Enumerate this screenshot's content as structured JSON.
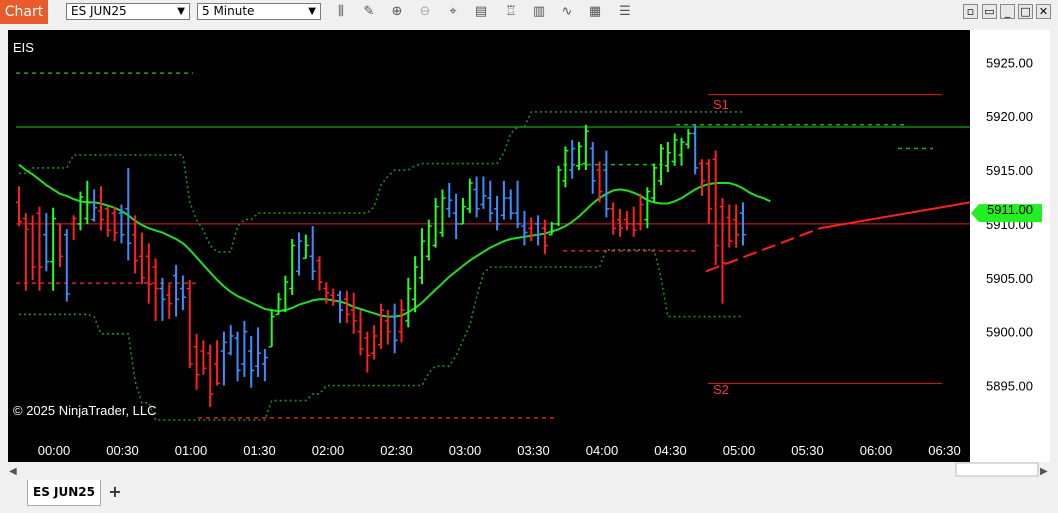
{
  "toolbar": {
    "app_label": "Chart",
    "instrument": "ES JUN25",
    "interval": "5 Minute",
    "tools": [
      "bar-type-icon",
      "draw-icon",
      "zoom-in-icon",
      "zoom-out-icon",
      "crosshair-icon",
      "data-box-icon",
      "strategies-icon",
      "indicators-icon",
      "drawing-tools-icon",
      "properties-icon",
      "chart-trader-icon"
    ],
    "window_buttons": [
      "snap-icon",
      "minimize-icon",
      "maximize-icon",
      "close-icon"
    ]
  },
  "chart": {
    "panel_label": "EIS",
    "copyright": "© 2025 NinjaTrader, LLC",
    "current_price_label": "5911.00",
    "s1_label": "S1",
    "s2_label": "S2",
    "colors": {
      "background": "#000000",
      "up": "#22ff22",
      "down": "#ff2020",
      "neutral": "#3a8eff",
      "ma": "#22dd22",
      "band": "#1f8f1f",
      "axis_text": "#ffffff"
    }
  },
  "chart_data": {
    "type": "bar",
    "instrument": "ES JUN25",
    "interval": "5 Minute",
    "y_ticks": [
      5925.0,
      5920.0,
      5915.0,
      5910.0,
      5905.0,
      5900.0,
      5895.0
    ],
    "x_ticks": [
      "00:00",
      "00:30",
      "01:00",
      "01:30",
      "02:00",
      "02:30",
      "03:00",
      "03:30",
      "04:00",
      "04:30",
      "05:00",
      "05:30",
      "06:00",
      "06:30"
    ],
    "ylim": [
      5890.5,
      5928
    ],
    "current_price": 5911.0,
    "levels": {
      "s1": 5922.0,
      "s2": 5895.2,
      "resistance": 5919.0,
      "support": 5910.0
    },
    "bars": [
      {
        "h": 5913.5,
        "l": 5909.8,
        "o": 5912.0,
        "c": 5910.2,
        "col": "r"
      },
      {
        "h": 5911.0,
        "l": 5903.8,
        "o": 5910.5,
        "c": 5909.5,
        "col": "r"
      },
      {
        "h": 5910.8,
        "l": 5904.8,
        "o": 5910.0,
        "c": 5906.0,
        "col": "r"
      },
      {
        "h": 5911.6,
        "l": 5903.8,
        "o": 5911.0,
        "c": 5906.0,
        "col": "r"
      },
      {
        "h": 5911.0,
        "l": 5905.6,
        "o": 5909.0,
        "c": 5906.5,
        "col": "b"
      },
      {
        "h": 5911.5,
        "l": 5903.8,
        "o": 5906.5,
        "c": 5910.5,
        "col": "g"
      },
      {
        "h": 5910.0,
        "l": 5906.0,
        "o": 5910.0,
        "c": 5907.0,
        "col": "r"
      },
      {
        "h": 5909.5,
        "l": 5902.8,
        "o": 5909.0,
        "c": 5903.5,
        "col": "b"
      },
      {
        "h": 5910.8,
        "l": 5908.5,
        "o": 5910.0,
        "c": 5910.5,
        "col": "r"
      },
      {
        "h": 5913.0,
        "l": 5909.4,
        "o": 5910.0,
        "c": 5912.5,
        "col": "g"
      },
      {
        "h": 5914.0,
        "l": 5910.0,
        "o": 5910.5,
        "c": 5912.0,
        "col": "g"
      },
      {
        "h": 5913.2,
        "l": 5910.2,
        "o": 5910.4,
        "c": 5911.5,
        "col": "b"
      },
      {
        "h": 5913.5,
        "l": 5909.4,
        "o": 5911.2,
        "c": 5910.4,
        "col": "r"
      },
      {
        "h": 5911.6,
        "l": 5908.8,
        "o": 5911.4,
        "c": 5909.4,
        "col": "r"
      },
      {
        "h": 5911.6,
        "l": 5908.4,
        "o": 5911.0,
        "c": 5909.2,
        "col": "r"
      },
      {
        "h": 5911.8,
        "l": 5908.2,
        "o": 5911.0,
        "c": 5909.0,
        "col": "b"
      },
      {
        "h": 5915.2,
        "l": 5906.6,
        "o": 5911.4,
        "c": 5908.2,
        "col": "b"
      },
      {
        "h": 5910.8,
        "l": 5905.4,
        "o": 5909.0,
        "c": 5906.6,
        "col": "r"
      },
      {
        "h": 5909.2,
        "l": 5904.4,
        "o": 5907.0,
        "c": 5905.0,
        "col": "r"
      },
      {
        "h": 5908.2,
        "l": 5902.6,
        "o": 5907.0,
        "c": 5904.4,
        "col": "r"
      },
      {
        "h": 5906.8,
        "l": 5901.0,
        "o": 5906.0,
        "c": 5904.0,
        "col": "r"
      },
      {
        "h": 5905.0,
        "l": 5901.0,
        "o": 5904.0,
        "c": 5903.0,
        "col": "b"
      },
      {
        "h": 5904.4,
        "l": 5901.2,
        "o": 5903.4,
        "c": 5902.6,
        "col": "r"
      },
      {
        "h": 5906.2,
        "l": 5901.4,
        "o": 5905.2,
        "c": 5903.0,
        "col": "b"
      },
      {
        "h": 5905.2,
        "l": 5902.0,
        "o": 5904.0,
        "c": 5903.2,
        "col": "b"
      },
      {
        "h": 5904.8,
        "l": 5896.6,
        "o": 5904.0,
        "c": 5897.0,
        "col": "r"
      },
      {
        "h": 5899.8,
        "l": 5894.6,
        "o": 5898.6,
        "c": 5896.0,
        "col": "r"
      },
      {
        "h": 5899.2,
        "l": 5896.0,
        "o": 5898.2,
        "c": 5896.6,
        "col": "r"
      },
      {
        "h": 5898.8,
        "l": 5893.0,
        "o": 5898.0,
        "c": 5894.2,
        "col": "r"
      },
      {
        "h": 5899.2,
        "l": 5895.0,
        "o": 5897.0,
        "c": 5895.2,
        "col": "r"
      },
      {
        "h": 5900.0,
        "l": 5895.0,
        "o": 5898.2,
        "c": 5899.0,
        "col": "b"
      },
      {
        "h": 5900.6,
        "l": 5897.8,
        "o": 5898.0,
        "c": 5899.6,
        "col": "b"
      },
      {
        "h": 5900.0,
        "l": 5895.4,
        "o": 5899.4,
        "c": 5896.4,
        "col": "b"
      },
      {
        "h": 5901.0,
        "l": 5895.8,
        "o": 5897.0,
        "c": 5900.0,
        "col": "b"
      },
      {
        "h": 5899.6,
        "l": 5894.8,
        "o": 5898.2,
        "c": 5896.4,
        "col": "b"
      },
      {
        "h": 5900.4,
        "l": 5895.8,
        "o": 5896.8,
        "c": 5898.0,
        "col": "b"
      },
      {
        "h": 5898.4,
        "l": 5895.4,
        "o": 5897.0,
        "c": 5897.6,
        "col": "b"
      },
      {
        "h": 5902.0,
        "l": 5898.6,
        "o": 5898.6,
        "c": 5901.4,
        "col": "g"
      },
      {
        "h": 5903.6,
        "l": 5901.6,
        "o": 5901.6,
        "c": 5903.0,
        "col": "g"
      },
      {
        "h": 5905.2,
        "l": 5901.8,
        "o": 5902.0,
        "c": 5904.6,
        "col": "g"
      },
      {
        "h": 5908.6,
        "l": 5903.4,
        "o": 5904.0,
        "c": 5908.0,
        "col": "g"
      },
      {
        "h": 5909.2,
        "l": 5905.2,
        "o": 5905.6,
        "c": 5908.4,
        "col": "b"
      },
      {
        "h": 5909.0,
        "l": 5906.8,
        "o": 5906.8,
        "c": 5908.0,
        "col": "g"
      },
      {
        "h": 5909.8,
        "l": 5904.8,
        "o": 5907.0,
        "c": 5905.6,
        "col": "b"
      },
      {
        "h": 5907.0,
        "l": 5903.8,
        "o": 5906.6,
        "c": 5904.6,
        "col": "r"
      },
      {
        "h": 5904.6,
        "l": 5902.6,
        "o": 5904.0,
        "c": 5903.6,
        "col": "r"
      },
      {
        "h": 5904.0,
        "l": 5902.4,
        "o": 5903.4,
        "c": 5902.8,
        "col": "r"
      },
      {
        "h": 5903.8,
        "l": 5900.8,
        "o": 5903.4,
        "c": 5902.0,
        "col": "b"
      },
      {
        "h": 5903.8,
        "l": 5900.8,
        "o": 5903.0,
        "c": 5901.6,
        "col": "r"
      },
      {
        "h": 5903.6,
        "l": 5899.8,
        "o": 5902.0,
        "c": 5901.0,
        "col": "r"
      },
      {
        "h": 5902.0,
        "l": 5897.8,
        "o": 5900.0,
        "c": 5898.4,
        "col": "r"
      },
      {
        "h": 5900.0,
        "l": 5896.2,
        "o": 5899.4,
        "c": 5897.8,
        "col": "r"
      },
      {
        "h": 5900.6,
        "l": 5897.4,
        "o": 5898.0,
        "c": 5899.6,
        "col": "r"
      },
      {
        "h": 5902.6,
        "l": 5898.4,
        "o": 5898.8,
        "c": 5902.0,
        "col": "r"
      },
      {
        "h": 5902.0,
        "l": 5898.8,
        "o": 5901.0,
        "c": 5900.0,
        "col": "r"
      },
      {
        "h": 5902.6,
        "l": 5898.0,
        "o": 5901.4,
        "c": 5899.2,
        "col": "b"
      },
      {
        "h": 5903.0,
        "l": 5899.0,
        "o": 5900.0,
        "c": 5902.0,
        "col": "r"
      },
      {
        "h": 5905.0,
        "l": 5900.4,
        "o": 5901.0,
        "c": 5904.0,
        "col": "g"
      },
      {
        "h": 5907.0,
        "l": 5901.8,
        "o": 5903.0,
        "c": 5906.0,
        "col": "g"
      },
      {
        "h": 5909.6,
        "l": 5904.4,
        "o": 5905.0,
        "c": 5908.4,
        "col": "g"
      },
      {
        "h": 5910.4,
        "l": 5906.6,
        "o": 5907.0,
        "c": 5909.8,
        "col": "g"
      },
      {
        "h": 5912.4,
        "l": 5907.8,
        "o": 5908.0,
        "c": 5911.6,
        "col": "g"
      },
      {
        "h": 5913.2,
        "l": 5908.8,
        "o": 5909.2,
        "c": 5912.4,
        "col": "g"
      },
      {
        "h": 5913.8,
        "l": 5910.6,
        "o": 5911.4,
        "c": 5912.2,
        "col": "b"
      },
      {
        "h": 5912.8,
        "l": 5908.6,
        "o": 5911.0,
        "c": 5910.0,
        "col": "b"
      },
      {
        "h": 5912.4,
        "l": 5910.0,
        "o": 5910.0,
        "c": 5911.6,
        "col": "g"
      },
      {
        "h": 5914.2,
        "l": 5911.0,
        "o": 5911.4,
        "c": 5913.8,
        "col": "g"
      },
      {
        "h": 5914.4,
        "l": 5910.6,
        "o": 5913.2,
        "c": 5911.4,
        "col": "b"
      },
      {
        "h": 5914.4,
        "l": 5911.4,
        "o": 5911.8,
        "c": 5912.6,
        "col": "b"
      },
      {
        "h": 5914.0,
        "l": 5910.2,
        "o": 5912.4,
        "c": 5911.0,
        "col": "b"
      },
      {
        "h": 5912.6,
        "l": 5909.4,
        "o": 5911.4,
        "c": 5910.0,
        "col": "b"
      },
      {
        "h": 5914.0,
        "l": 5910.4,
        "o": 5910.8,
        "c": 5912.4,
        "col": "b"
      },
      {
        "h": 5913.2,
        "l": 5910.4,
        "o": 5912.4,
        "c": 5911.0,
        "col": "b"
      },
      {
        "h": 5914.0,
        "l": 5909.6,
        "o": 5911.0,
        "c": 5910.0,
        "col": "b"
      },
      {
        "h": 5911.2,
        "l": 5908.0,
        "o": 5909.8,
        "c": 5909.2,
        "col": "b"
      },
      {
        "h": 5910.6,
        "l": 5908.4,
        "o": 5909.6,
        "c": 5909.0,
        "col": "r"
      },
      {
        "h": 5910.8,
        "l": 5908.0,
        "o": 5910.0,
        "c": 5909.0,
        "col": "b"
      },
      {
        "h": 5910.4,
        "l": 5907.2,
        "o": 5909.6,
        "c": 5908.0,
        "col": "r"
      },
      {
        "h": 5910.2,
        "l": 5909.0,
        "o": 5909.0,
        "c": 5910.0,
        "col": "g"
      },
      {
        "h": 5915.4,
        "l": 5909.8,
        "o": 5910.0,
        "c": 5915.0,
        "col": "g"
      },
      {
        "h": 5917.2,
        "l": 5913.4,
        "o": 5914.0,
        "c": 5916.8,
        "col": "g"
      },
      {
        "h": 5917.8,
        "l": 5914.2,
        "o": 5915.0,
        "c": 5917.0,
        "col": "b"
      },
      {
        "h": 5917.6,
        "l": 5915.0,
        "o": 5915.4,
        "c": 5917.2,
        "col": "g"
      },
      {
        "h": 5919.2,
        "l": 5915.0,
        "o": 5915.6,
        "c": 5918.6,
        "col": "g"
      },
      {
        "h": 5917.6,
        "l": 5912.8,
        "o": 5917.0,
        "c": 5914.0,
        "col": "b"
      },
      {
        "h": 5915.8,
        "l": 5912.0,
        "o": 5915.0,
        "c": 5913.0,
        "col": "r"
      },
      {
        "h": 5916.8,
        "l": 5910.6,
        "o": 5915.0,
        "c": 5911.4,
        "col": "b"
      },
      {
        "h": 5912.0,
        "l": 5909.0,
        "o": 5911.4,
        "c": 5909.6,
        "col": "r"
      },
      {
        "h": 5911.4,
        "l": 5908.8,
        "o": 5910.4,
        "c": 5909.6,
        "col": "r"
      },
      {
        "h": 5911.2,
        "l": 5909.4,
        "o": 5910.4,
        "c": 5910.0,
        "col": "r"
      },
      {
        "h": 5911.6,
        "l": 5908.8,
        "o": 5910.0,
        "c": 5909.4,
        "col": "r"
      },
      {
        "h": 5912.8,
        "l": 5909.4,
        "o": 5910.0,
        "c": 5911.8,
        "col": "r"
      },
      {
        "h": 5913.4,
        "l": 5909.6,
        "o": 5910.4,
        "c": 5913.0,
        "col": "g"
      },
      {
        "h": 5915.6,
        "l": 5912.0,
        "o": 5912.4,
        "c": 5915.2,
        "col": "g"
      },
      {
        "h": 5917.4,
        "l": 5913.6,
        "o": 5914.0,
        "c": 5917.0,
        "col": "g"
      },
      {
        "h": 5917.6,
        "l": 5914.8,
        "o": 5915.4,
        "c": 5916.6,
        "col": "g"
      },
      {
        "h": 5918.4,
        "l": 5915.4,
        "o": 5915.8,
        "c": 5917.8,
        "col": "g"
      },
      {
        "h": 5918.0,
        "l": 5915.4,
        "o": 5916.4,
        "c": 5917.6,
        "col": "g"
      },
      {
        "h": 5918.8,
        "l": 5917.0,
        "o": 5917.4,
        "c": 5918.4,
        "col": "g"
      },
      {
        "h": 5919.2,
        "l": 5914.6,
        "o": 5918.4,
        "c": 5915.2,
        "col": "b"
      },
      {
        "h": 5916.0,
        "l": 5912.6,
        "o": 5915.6,
        "c": 5914.0,
        "col": "r"
      },
      {
        "h": 5916.0,
        "l": 5910.0,
        "o": 5915.6,
        "c": 5911.4,
        "col": "r"
      },
      {
        "h": 5916.8,
        "l": 5906.2,
        "o": 5916.0,
        "c": 5908.0,
        "col": "r"
      },
      {
        "h": 5912.4,
        "l": 5902.6,
        "o": 5911.6,
        "c": 5906.4,
        "col": "r"
      },
      {
        "h": 5911.8,
        "l": 5907.8,
        "o": 5910.6,
        "c": 5908.4,
        "col": "r"
      },
      {
        "h": 5911.8,
        "l": 5907.8,
        "o": 5910.4,
        "c": 5909.0,
        "col": "r"
      },
      {
        "h": 5912.0,
        "l": 5908.0,
        "o": 5911.0,
        "c": 5909.0,
        "col": "b"
      }
    ],
    "ma": [
      5915.5,
      5915.0,
      5914.6,
      5914.1,
      5913.6,
      5913.2,
      5912.8,
      5912.6,
      5912.3,
      5912.1,
      5912.0,
      5912.0,
      5911.9,
      5911.7,
      5911.5,
      5911.2,
      5910.8,
      5910.3,
      5909.9,
      5909.6,
      5909.4,
      5909.2,
      5908.9,
      5908.6,
      5908.2,
      5907.6,
      5906.9,
      5906.2,
      5905.5,
      5904.8,
      5904.2,
      5903.7,
      5903.3,
      5903.0,
      5902.7,
      5902.4,
      5902.1,
      5902.0,
      5901.9,
      5902.0,
      5902.2,
      5902.5,
      5902.7,
      5902.9,
      5903.0,
      5903.0,
      5902.9,
      5902.8,
      5902.6,
      5902.3,
      5902.1,
      5901.9,
      5901.7,
      5901.5,
      5901.4,
      5901.4,
      5901.5,
      5901.8,
      5902.2,
      5902.7,
      5903.3,
      5903.9,
      5904.5,
      5905.1,
      5905.6,
      5906.1,
      5906.6,
      5907.0,
      5907.4,
      5907.8,
      5908.1,
      5908.4,
      5908.6,
      5908.7,
      5908.8,
      5908.9,
      5909.0,
      5909.1,
      5909.3,
      5909.5,
      5909.8,
      5910.2,
      5910.7,
      5911.3,
      5911.9,
      5912.4,
      5912.8,
      5913.1,
      5913.2,
      5913.1,
      5912.9,
      5912.6,
      5912.2,
      5912.0,
      5911.9,
      5911.9,
      5912.1,
      5912.4,
      5912.8,
      5913.2,
      5913.5,
      5913.7,
      5913.8,
      5913.8,
      5913.8,
      5913.6,
      5913.3,
      5912.9,
      5912.6,
      5912.4,
      5912.1
    ]
  }
}
